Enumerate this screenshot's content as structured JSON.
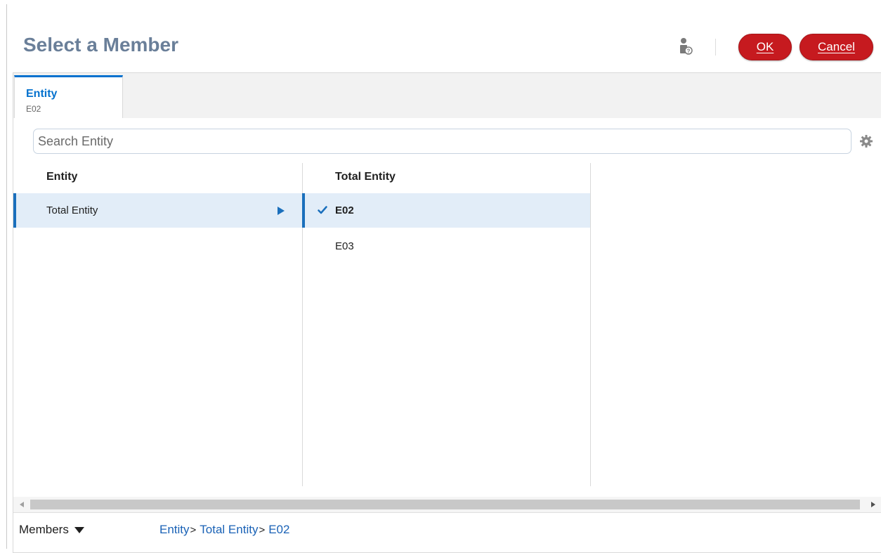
{
  "dialog": {
    "title": "Select a Member",
    "ok_label": "OK",
    "cancel_label": "Cancel"
  },
  "tab": {
    "title": "Entity",
    "value": "E02"
  },
  "search": {
    "placeholder": "Search Entity"
  },
  "columns": [
    {
      "header": "Entity",
      "items": [
        {
          "label": "Total Entity",
          "selected": true,
          "expandable": true
        }
      ]
    },
    {
      "header": "Total Entity",
      "items": [
        {
          "label": "E02",
          "selected": true,
          "checked": true
        },
        {
          "label": "E03",
          "selected": false
        }
      ]
    }
  ],
  "footer": {
    "members_label": "Members",
    "breadcrumb": [
      "Entity",
      "Total Entity",
      "E02"
    ],
    "separator": ">"
  },
  "icons": {
    "help": "user-help-icon",
    "settings": "gear-icon",
    "expand": "play-arrow-icon",
    "check": "checkmark-icon",
    "dropdown": "caret-down-icon"
  },
  "colors": {
    "title": "#6a7f99",
    "button": "#c61a1f",
    "accent": "#0572ce",
    "selected_row": "#e2edf8",
    "link": "#1a62b6"
  }
}
